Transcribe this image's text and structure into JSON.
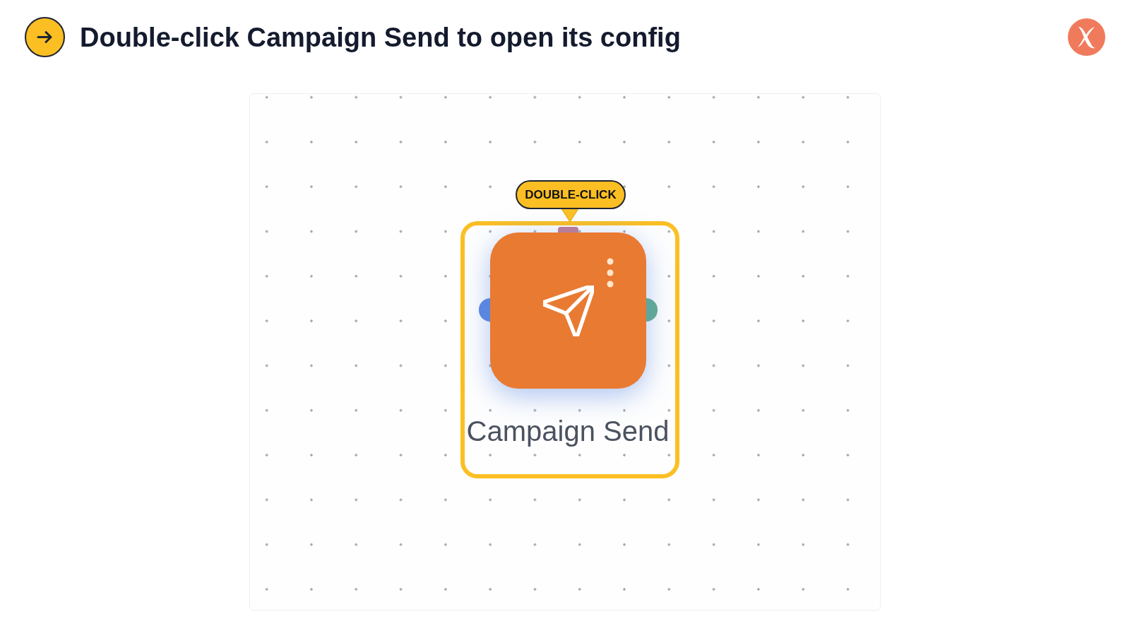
{
  "header": {
    "title": "Double-click Campaign Send to open its config"
  },
  "canvas": {
    "callout": {
      "text": "DOUBLE-CLICK"
    },
    "node": {
      "label": "Campaign Send",
      "highlighted": true,
      "ports": [
        {
          "kind": "top",
          "color": "#c47a92"
        },
        {
          "kind": "left",
          "color": "#5a86e0"
        },
        {
          "kind": "right",
          "color": "#5fae8b"
        }
      ]
    }
  }
}
